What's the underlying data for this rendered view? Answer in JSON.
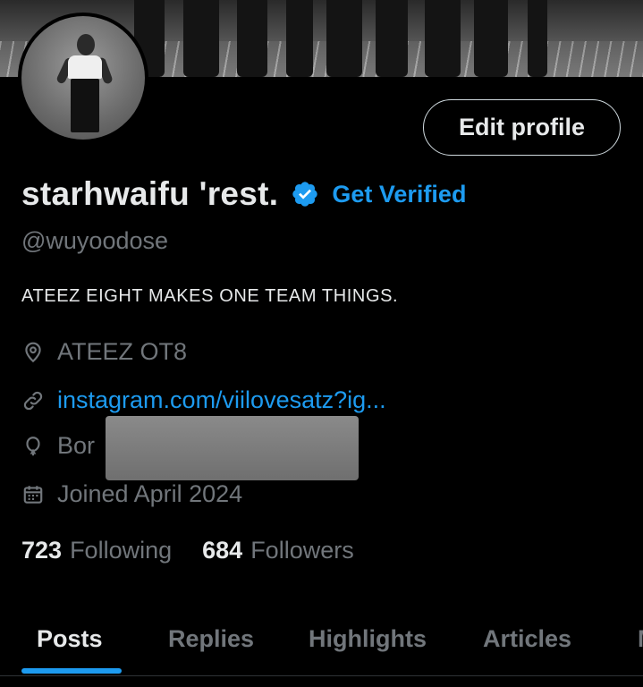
{
  "profile": {
    "display_name": "starhwaifu 'rest.",
    "get_verified_label": "Get Verified",
    "handle": "@wuyoodose",
    "bio": "ATEEZ EIGHT MAKES ONE TEAM THINGS.",
    "edit_profile_label": "Edit profile"
  },
  "meta": {
    "location": "ATEEZ OT8",
    "website": "instagram.com/viilovesatz?ig...",
    "birthday": "Bor",
    "joined": "Joined April 2024"
  },
  "stats": {
    "following_count": "723",
    "following_label": "Following",
    "followers_count": "684",
    "followers_label": "Followers"
  },
  "tabs": [
    {
      "label": "Posts",
      "active": true
    },
    {
      "label": "Replies",
      "active": false
    },
    {
      "label": "Highlights",
      "active": false
    },
    {
      "label": "Articles",
      "active": false
    },
    {
      "label": "M",
      "active": false
    }
  ],
  "colors": {
    "accent": "#1d9bf0",
    "background": "#000000",
    "text_primary": "#e7e9ea",
    "text_secondary": "#71767b"
  },
  "icons": {
    "verified": "verified-badge-icon",
    "location": "location-pin-icon",
    "link": "link-icon",
    "birthday": "balloon-icon",
    "joined": "calendar-icon"
  }
}
